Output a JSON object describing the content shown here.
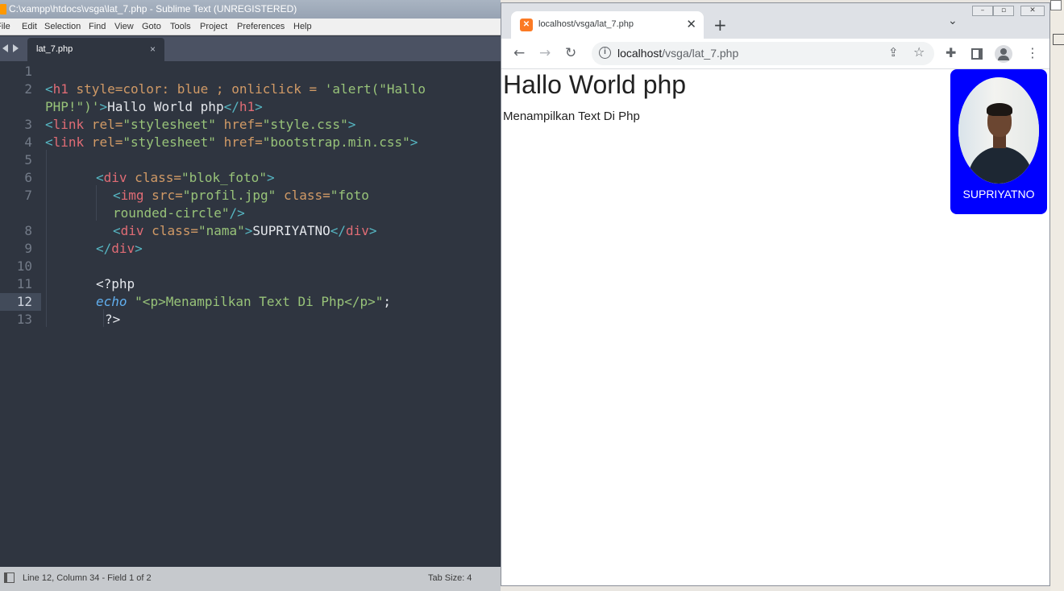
{
  "sublime": {
    "title": "C:\\xampp\\htdocs\\vsga\\lat_7.php - Sublime Text (UNREGISTERED)",
    "menu": [
      "File",
      "Edit",
      "Selection",
      "Find",
      "View",
      "Goto",
      "Tools",
      "Project",
      "Preferences",
      "Help"
    ],
    "tab": {
      "label": "lat_7.php",
      "close": "×"
    },
    "status": {
      "position": "Line 12, Column 34 - Field 1 of 2",
      "tab_size": "Tab Size: 4"
    },
    "line_numbers": [
      "1",
      "2",
      "3",
      "4",
      "5",
      "6",
      "7",
      "8",
      "9",
      "10",
      "11",
      "12",
      "13"
    ],
    "code": {
      "l2a": [
        "<",
        "h1",
        " style=color: blue ; onliclick = ",
        "'alert(\"Hallo"
      ],
      "l2b": [
        "PHP!\")'",
        ">",
        "Hallo World php",
        "</",
        "h1",
        ">"
      ],
      "l3": [
        "<",
        "link",
        " rel=",
        "\"stylesheet\"",
        " href=",
        "\"style.css\"",
        ">"
      ],
      "l4": [
        "<",
        "link",
        " rel=",
        "\"stylesheet\"",
        " href=",
        "\"bootstrap.min.css\"",
        ">"
      ],
      "l6": [
        "<",
        "div",
        " class=",
        "\"blok_foto\"",
        ">"
      ],
      "l7a": [
        "<",
        "img",
        " src=",
        "\"profil.jpg\"",
        " class=",
        "\"foto"
      ],
      "l7b": [
        "rounded-circle\"",
        "/>"
      ],
      "l8": [
        "<",
        "div",
        " class=",
        "\"nama\"",
        ">",
        "SUPRIYATNO",
        "</",
        "div",
        ">"
      ],
      "l9": [
        "</",
        "div",
        ">"
      ],
      "l11": "<?php",
      "l12": [
        "echo",
        " ",
        "\"<p>Menampilkan Text Di Php</p>\"",
        ";"
      ],
      "l13": "?>"
    }
  },
  "chrome": {
    "tab_title": "localhost/vsga/lat_7.php",
    "tab_close": "✕",
    "new_tab": "+",
    "url_host": "localhost",
    "url_path": "/vsga/lat_7.php",
    "icons": {
      "back": "back-arrow-icon",
      "forward": "forward-arrow-icon",
      "reload": "reload-icon",
      "info": "site-info-icon",
      "share": "share-icon",
      "star": "bookmark-star-icon",
      "extensions": "extensions-puzzle-icon",
      "sidepanel": "side-panel-icon",
      "profile": "profile-icon",
      "menu": "kebab-menu-icon"
    },
    "page": {
      "h1": "Hallo World php",
      "p": "Menampilkan Text Di Php",
      "nama": "SUPRIYATNO",
      "blok_color": "#0000ff"
    }
  }
}
